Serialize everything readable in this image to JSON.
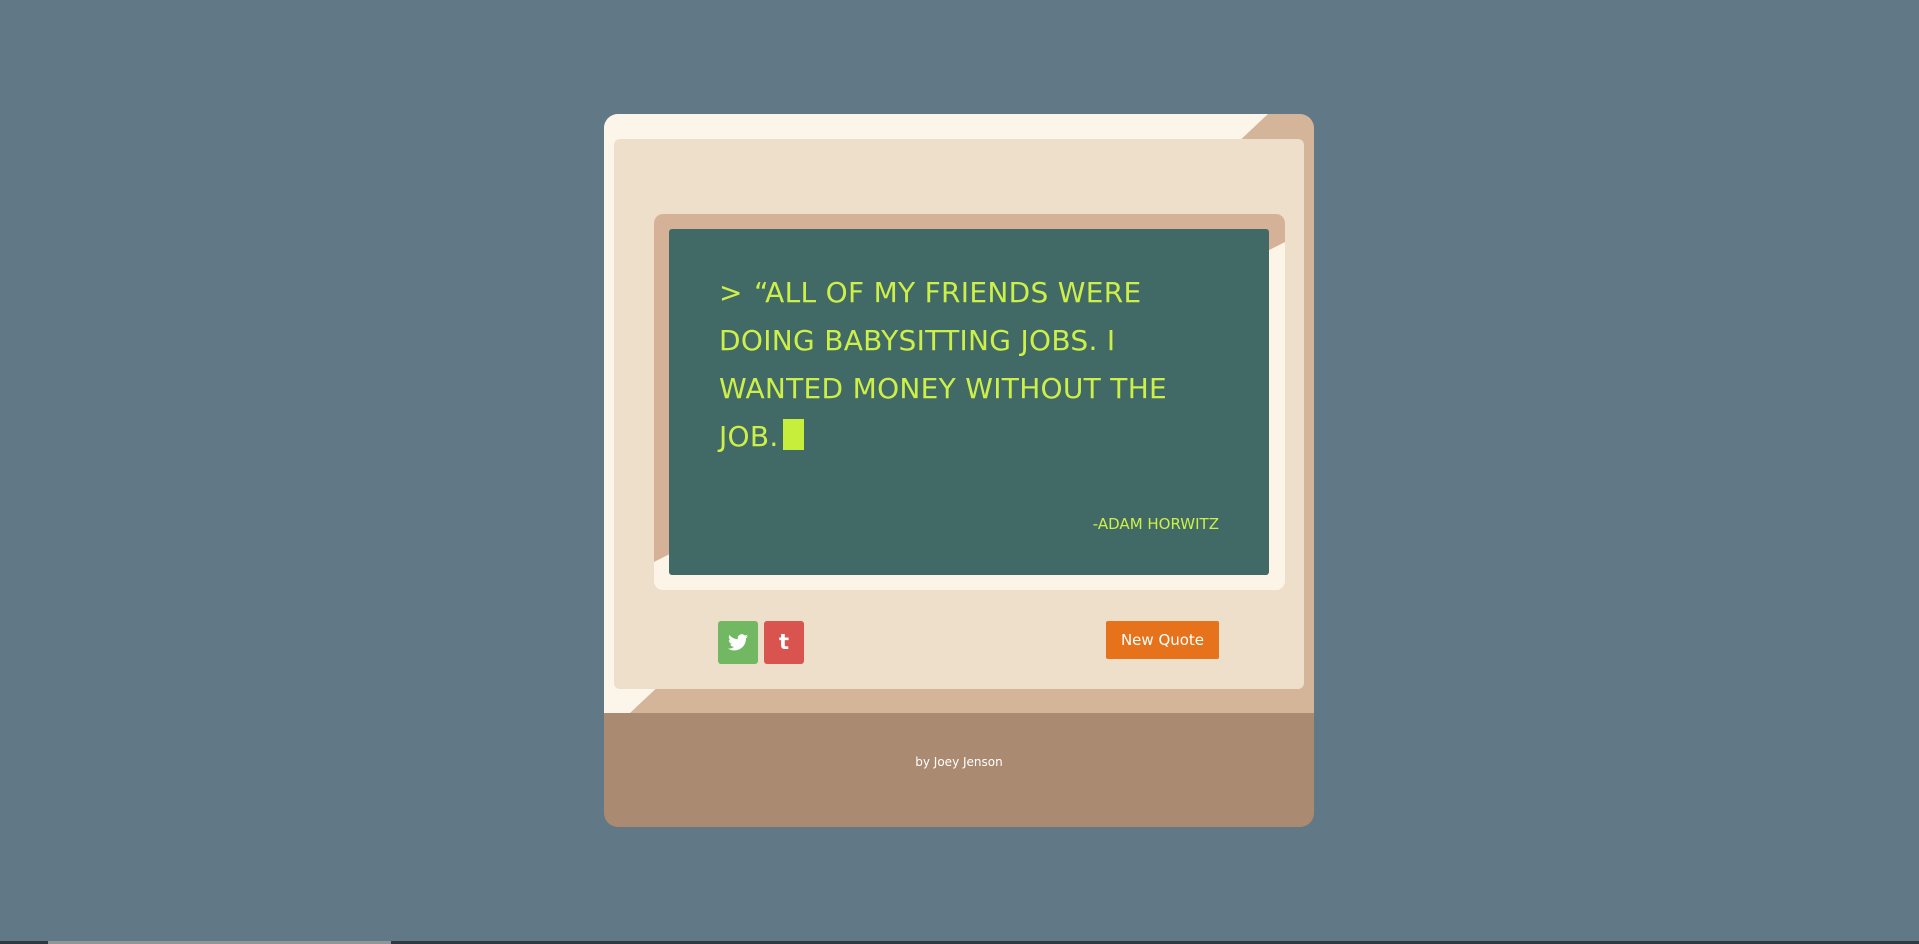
{
  "quote": {
    "prompt": ">",
    "text": "“All of my friends were doing babysitting jobs. I wanted money without the job.",
    "author": "-Adam Horwitz"
  },
  "actions": {
    "twitter_icon": "twitter-icon",
    "tumblr_icon": "tumblr-icon",
    "tumblr_glyph": "t",
    "new_quote_label": "New Quote"
  },
  "footer": {
    "credit": "by Joey Jenson"
  },
  "colors": {
    "background": "#617886",
    "screen": "#416a67",
    "text": "#cdf048",
    "twitter": "#72b863",
    "tumblr": "#d9534f",
    "button": "#e6731b",
    "stand": "#ab8a72"
  }
}
